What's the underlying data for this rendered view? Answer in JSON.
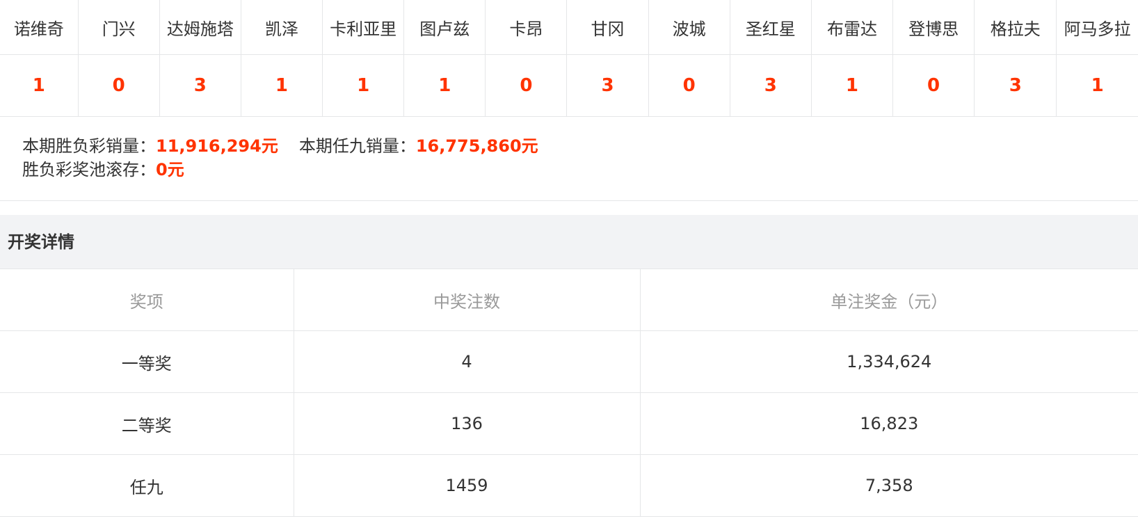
{
  "matches": {
    "teams": [
      "诺维奇",
      "门兴",
      "达姆施塔",
      "凯泽",
      "卡利亚里",
      "图卢兹",
      "卡昂",
      "甘冈",
      "波城",
      "圣红星",
      "布雷达",
      "登博思",
      "格拉夫",
      "阿马多拉"
    ],
    "results": [
      "1",
      "0",
      "3",
      "1",
      "1",
      "1",
      "0",
      "3",
      "0",
      "3",
      "1",
      "0",
      "3",
      "1"
    ]
  },
  "sales": {
    "sfc_label": "本期胜负彩销量：",
    "sfc_value": "11,916,294元",
    "r9_label": "本期任九销量：",
    "r9_value": "16,775,860元",
    "pool_label": "胜负彩奖池滚存：",
    "pool_value": "0元"
  },
  "details": {
    "title": "开奖详情",
    "headers": [
      "奖项",
      "中奖注数",
      "单注奖金（元）"
    ],
    "rows": [
      [
        "一等奖",
        "4",
        "1,334,624"
      ],
      [
        "二等奖",
        "136",
        "16,823"
      ],
      [
        "任九",
        "1459",
        "7,358"
      ]
    ]
  },
  "colors": {
    "accent_red": "#ff3300",
    "header_bg": "#f2f3f5",
    "border": "#e5e6e8",
    "muted_text": "#999999"
  }
}
